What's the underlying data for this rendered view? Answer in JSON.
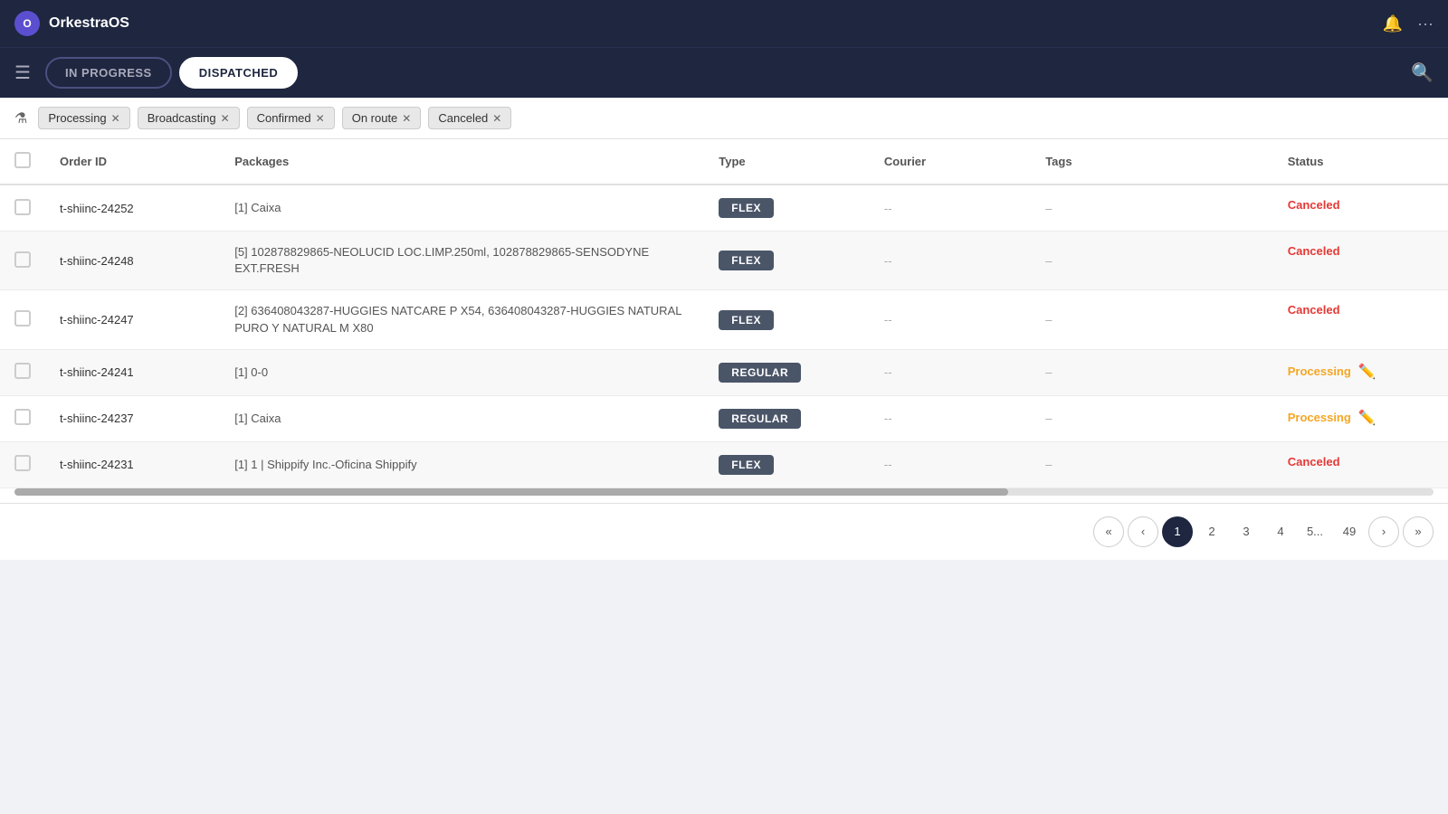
{
  "app": {
    "title": "OrkestraOS",
    "logo_text": "O"
  },
  "toolbar": {
    "tab_in_progress": "IN PROGRESS",
    "tab_dispatched": "DISPATCHED",
    "active_tab": "DISPATCHED"
  },
  "filters": {
    "label": "Filters",
    "chips": [
      {
        "id": "processing",
        "label": "Processing"
      },
      {
        "id": "broadcasting",
        "label": "Broadcasting"
      },
      {
        "id": "confirmed",
        "label": "Confirmed"
      },
      {
        "id": "on_route",
        "label": "On route"
      },
      {
        "id": "canceled",
        "label": "Canceled"
      }
    ]
  },
  "table": {
    "headers": [
      "",
      "Order ID",
      "Packages",
      "Type",
      "Courier",
      "Tags",
      "Status"
    ],
    "rows": [
      {
        "id": "t-shiinc-24252",
        "packages": "[1] Caixa",
        "type": "FLEX",
        "courier": "--",
        "tags": "–",
        "status": "Canceled",
        "status_class": "canceled"
      },
      {
        "id": "t-shiinc-24248",
        "packages": "[5] 102878829865-NEOLUCID LOC.LIMP.250ml, 102878829865-SENSODYNE EXT.FRESH",
        "type": "FLEX",
        "courier": "--",
        "tags": "–",
        "status": "Canceled",
        "status_class": "canceled"
      },
      {
        "id": "t-shiinc-24247",
        "packages": "[2] 636408043287-HUGGIES NATCARE P X54, 636408043287-HUGGIES NATURAL PURO Y NATURAL M X80",
        "type": "FLEX",
        "courier": "--",
        "tags": "–",
        "status": "Canceled",
        "status_class": "canceled"
      },
      {
        "id": "t-shiinc-24241",
        "packages": "[1] 0-0",
        "type": "REGULAR",
        "courier": "--",
        "tags": "–",
        "status": "Processing",
        "status_class": "processing"
      },
      {
        "id": "t-shiinc-24237",
        "packages": "[1] Caixa",
        "type": "REGULAR",
        "courier": "--",
        "tags": "–",
        "status": "Processing",
        "status_class": "processing"
      },
      {
        "id": "t-shiinc-24231",
        "packages": "[1] 1 | Shippify Inc.-Oficina Shippify",
        "type": "FLEX",
        "courier": "--",
        "tags": "–",
        "status": "Canceled",
        "status_class": "canceled"
      }
    ]
  },
  "pagination": {
    "pages": [
      "1",
      "2",
      "3",
      "4",
      "5...",
      "49"
    ],
    "current": "1",
    "ellipsis": "..."
  }
}
